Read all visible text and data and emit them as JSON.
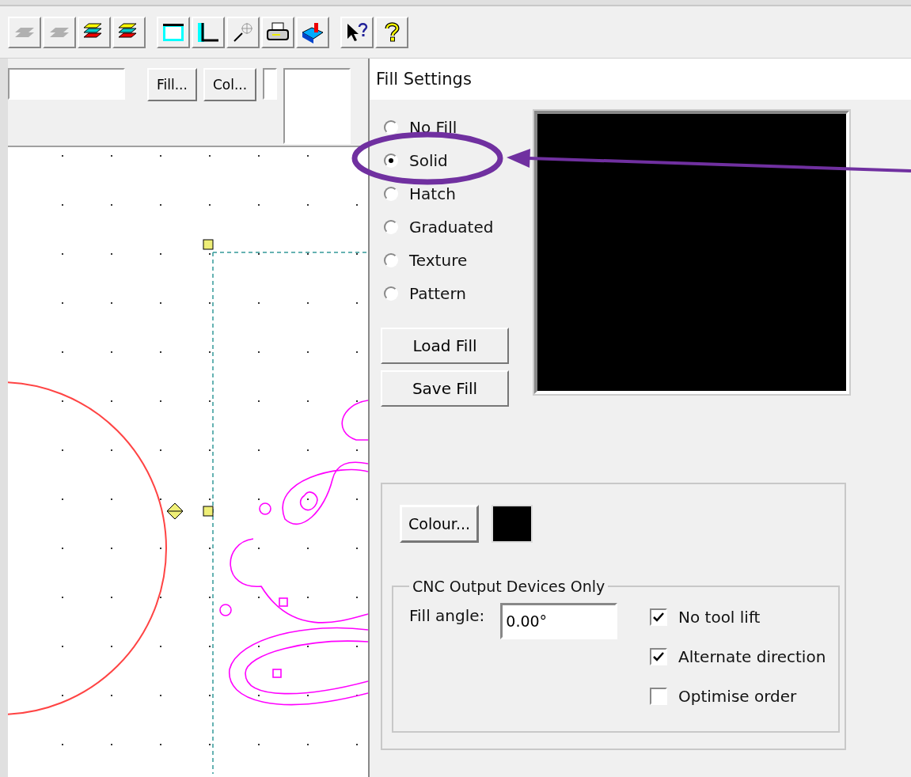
{
  "property_bar": {
    "buttons": [
      "Fill...",
      "Col..."
    ]
  },
  "dialog": {
    "title": "Fill Settings",
    "fill_types": [
      {
        "label": "No Fill",
        "selected": false
      },
      {
        "label": "Solid",
        "selected": true
      },
      {
        "label": "Hatch",
        "selected": false
      },
      {
        "label": "Graduated",
        "selected": false
      },
      {
        "label": "Texture",
        "selected": false
      },
      {
        "label": "Pattern",
        "selected": false
      }
    ],
    "buttons": [
      "Load Fill",
      "Save Fill"
    ],
    "colour_button": "Colour...",
    "cnc_group": {
      "legend": "CNC Output Devices Only",
      "fill_angle_label": "Fill angle:",
      "fill_angle_value": "0.00°",
      "options": [
        {
          "label": "No tool lift",
          "checked": true
        },
        {
          "label": "Alternate direction",
          "checked": true
        },
        {
          "label": "Optimise order",
          "checked": false
        }
      ]
    }
  }
}
